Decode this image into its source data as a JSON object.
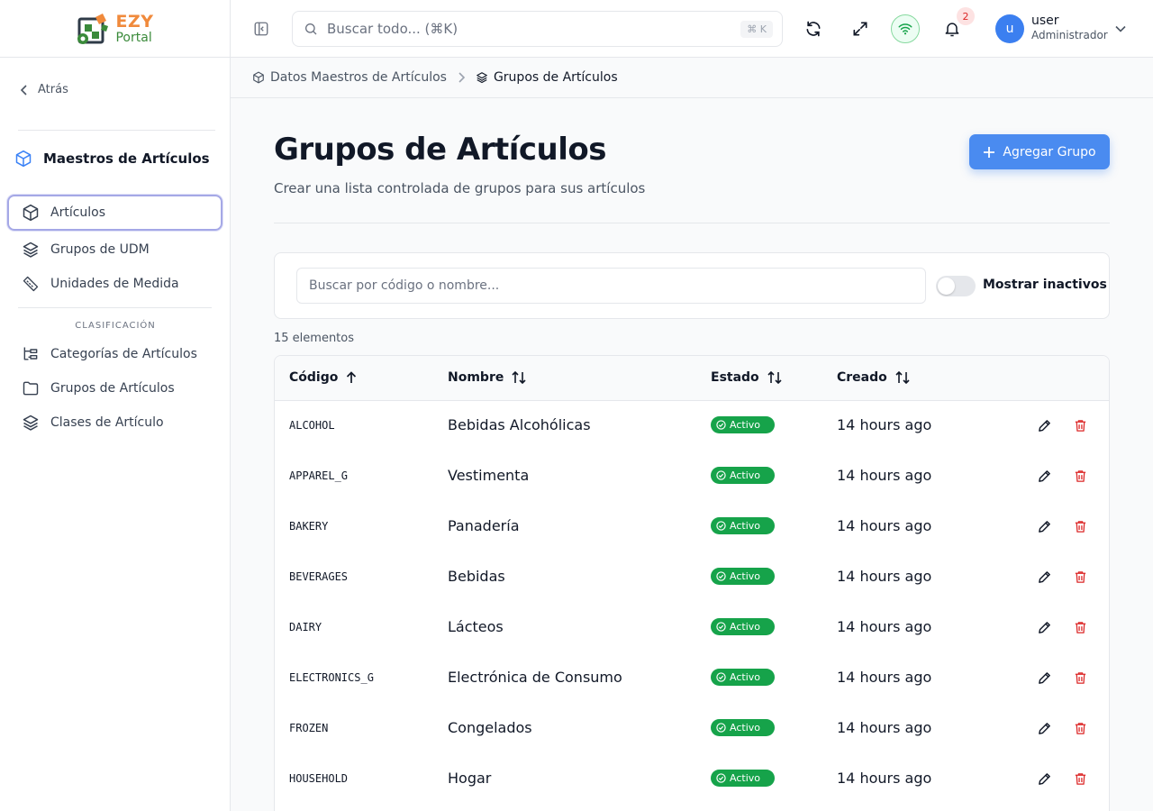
{
  "brand": {
    "name_top": "EZY",
    "name_bottom": "Portal"
  },
  "sidebar": {
    "back_label": "Atrás",
    "section_title": "Maestros de Artículos",
    "items": [
      {
        "label": "Artículos",
        "icon": "box-icon"
      },
      {
        "label": "Grupos de UDM",
        "icon": "layers-icon"
      },
      {
        "label": "Unidades de Medida",
        "icon": "ruler-icon"
      }
    ],
    "group_label": "CLASIFICACIÓN",
    "group_items": [
      {
        "label": "Categorías de Artículos",
        "icon": "tree-icon"
      },
      {
        "label": "Grupos de Artículos",
        "icon": "folder-icon"
      },
      {
        "label": "Clases de Artículo",
        "icon": "layers-icon"
      }
    ]
  },
  "header": {
    "search_placeholder": "Buscar todo... (⌘K)",
    "search_shortcut": "⌘ K",
    "notifications_count": "2",
    "user_initial": "u",
    "user_name": "user",
    "user_role": "Administrador"
  },
  "breadcrumb": [
    {
      "label": "Datos Maestros de Artículos"
    },
    {
      "label": "Grupos de Artículos"
    }
  ],
  "page": {
    "title": "Grupos de Artículos",
    "subtitle": "Crear una lista controlada de grupos para sus artículos",
    "add_button": "Agregar Grupo"
  },
  "filters": {
    "search_placeholder": "Buscar por código o nombre...",
    "show_inactive_label": "Mostrar inactivos",
    "show_inactive": false
  },
  "count_label": "15 elementos",
  "table": {
    "columns": [
      "Código",
      "Nombre",
      "Estado",
      "Creado"
    ],
    "rows": [
      {
        "code": "ALCOHOL",
        "name": "Bebidas Alcohólicas",
        "status": "Activo",
        "created": "14 hours ago"
      },
      {
        "code": "APPAREL_G",
        "name": "Vestimenta",
        "status": "Activo",
        "created": "14 hours ago"
      },
      {
        "code": "BAKERY",
        "name": "Panadería",
        "status": "Activo",
        "created": "14 hours ago"
      },
      {
        "code": "BEVERAGES",
        "name": "Bebidas",
        "status": "Activo",
        "created": "14 hours ago"
      },
      {
        "code": "DAIRY",
        "name": "Lácteos",
        "status": "Activo",
        "created": "14 hours ago"
      },
      {
        "code": "ELECTRONICS_G",
        "name": "Electrónica de Consumo",
        "status": "Activo",
        "created": "14 hours ago"
      },
      {
        "code": "FROZEN",
        "name": "Congelados",
        "status": "Activo",
        "created": "14 hours ago"
      },
      {
        "code": "HOUSEHOLD",
        "name": "Hogar",
        "status": "Activo",
        "created": "14 hours ago"
      }
    ]
  },
  "colors": {
    "primary": "#4a8bf0",
    "active_status": "#16a34a",
    "delete": "#dc2626",
    "logo_orange": "#f08a3c",
    "logo_green": "#3a8a3a"
  }
}
